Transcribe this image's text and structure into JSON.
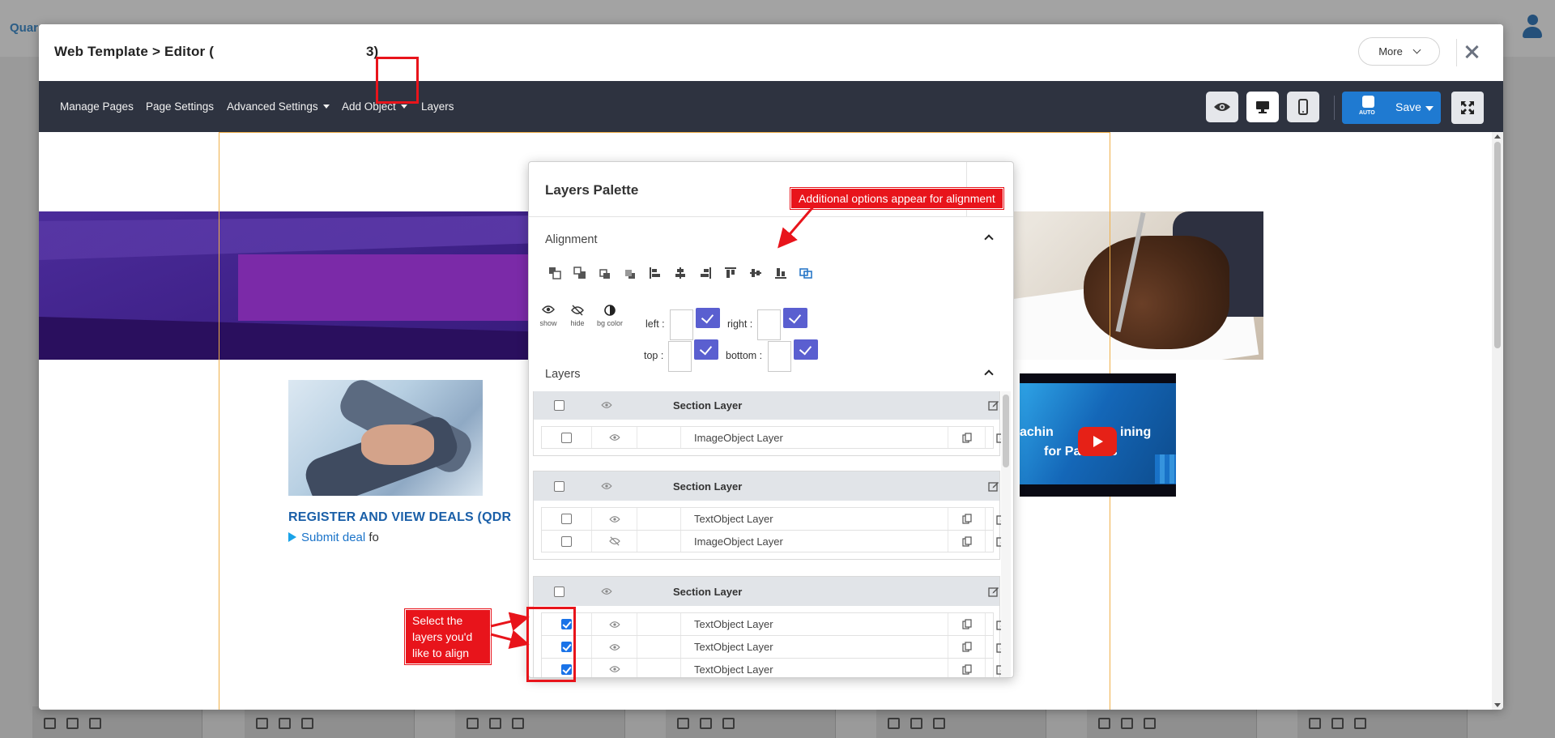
{
  "background": {
    "brand": "Quar"
  },
  "header": {
    "title": "Web Template > Editor (",
    "title_suffix": "3)",
    "more_label": "More"
  },
  "toolbar": {
    "manage_pages": "Manage Pages",
    "page_settings": "Page Settings",
    "advanced_settings": "Advanced Settings",
    "add_object": "Add Object",
    "layers": "Layers",
    "save_label": "Save",
    "auto_label": "AUTO"
  },
  "canvas": {
    "register_title": "REGISTER AND VIEW DEALS (QDR",
    "submit_link": "Submit deal",
    "submit_rest": "fo",
    "video_line1": "achin",
    "video_line2": "ining",
    "video_line3": "for Partners"
  },
  "palette": {
    "title": "Layers Palette",
    "alignment_title": "Alignment",
    "layers_title": "Layers",
    "vis": {
      "show": "show",
      "hide": "hide",
      "bg_color": "bg color"
    },
    "pos": {
      "left": "left :",
      "right": "right :",
      "top": "top :",
      "bottom": "bottom :"
    },
    "groups": [
      {
        "section": "Section Layer",
        "children": [
          {
            "name": "ImageObject Layer",
            "hidden": false,
            "checked": false
          }
        ]
      },
      {
        "section": "Section Layer",
        "children": [
          {
            "name": "TextObject Layer",
            "hidden": false,
            "checked": false
          },
          {
            "name": "ImageObject Layer",
            "hidden": true,
            "checked": false
          }
        ]
      },
      {
        "section": "Section Layer",
        "children": [
          {
            "name": "TextObject Layer",
            "hidden": false,
            "checked": true
          },
          {
            "name": "TextObject Layer",
            "hidden": false,
            "checked": true
          },
          {
            "name": "TextObject Layer",
            "hidden": false,
            "checked": true
          }
        ]
      }
    ]
  },
  "annotations": {
    "top": "Additional options appear for alignment",
    "left": "Select the layers you'd like to align"
  },
  "colors": {
    "toolbar_bg": "#2e3340",
    "save_blue": "#1f7ad1",
    "annotation_red": "#e8141b",
    "check_purple": "#5a5fd0"
  }
}
